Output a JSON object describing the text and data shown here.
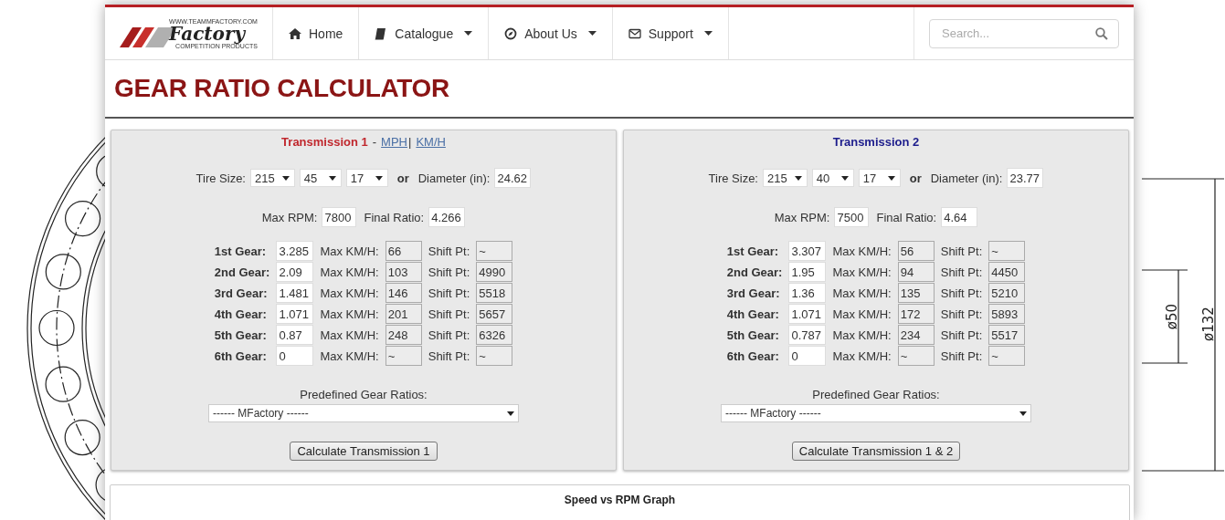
{
  "background_drawing": {
    "labels": [
      "ø50",
      "ø132"
    ]
  },
  "logo": {
    "url": "WWW.TEAMMFACTORY.COM",
    "wordmark": "Factory",
    "tagline": "COMPETITION PRODUCTS"
  },
  "nav": [
    {
      "label": "Home",
      "kind": "home",
      "dropdown": false
    },
    {
      "label": "Catalogue",
      "kind": "catalogue",
      "dropdown": true
    },
    {
      "label": "About Us",
      "kind": "about",
      "dropdown": true
    },
    {
      "label": "Support",
      "kind": "support",
      "dropdown": true
    }
  ],
  "search": {
    "placeholder": "Search..."
  },
  "page_title": "GEAR RATIO CALCULATOR",
  "transmissions": [
    {
      "title": "Transmission 1",
      "color": "#c0272d",
      "separator": "-",
      "units": [
        {
          "label": "MPH"
        },
        {
          "label": "KM/H"
        }
      ],
      "unit_separator": "|",
      "tire_label": "Tire Size:",
      "tire_selects": [
        "215",
        "45",
        "17"
      ],
      "or_label": "or",
      "diameter_label": "Diameter (in):",
      "diameter": "24.62",
      "max_rpm_label": "Max RPM:",
      "max_rpm": "7800",
      "final_ratio_label": "Final Ratio:",
      "final_ratio": "4.266",
      "gears": [
        {
          "label": "1st Gear:",
          "ratio": "3.285",
          "speed_label": "Max KM/H:",
          "speed": "66",
          "shift_label": "Shift Pt:",
          "shift": "~"
        },
        {
          "label": "2nd Gear:",
          "ratio": "2.09",
          "speed_label": "Max KM/H:",
          "speed": "103",
          "shift_label": "Shift Pt:",
          "shift": "4990"
        },
        {
          "label": "3rd Gear:",
          "ratio": "1.481",
          "speed_label": "Max KM/H:",
          "speed": "146",
          "shift_label": "Shift Pt:",
          "shift": "5518"
        },
        {
          "label": "4th Gear:",
          "ratio": "1.071",
          "speed_label": "Max KM/H:",
          "speed": "201",
          "shift_label": "Shift Pt:",
          "shift": "5657"
        },
        {
          "label": "5th Gear:",
          "ratio": "0.87",
          "speed_label": "Max KM/H:",
          "speed": "248",
          "shift_label": "Shift Pt:",
          "shift": "6326"
        },
        {
          "label": "6th Gear:",
          "ratio": "0",
          "speed_label": "Max KM/H:",
          "speed": "~",
          "shift_label": "Shift Pt:",
          "shift": "~"
        }
      ],
      "predefined_label": "Predefined Gear Ratios:",
      "predefined_value": "------ MFactory ------",
      "button": "Calculate Transmission 1"
    },
    {
      "title": "Transmission 2",
      "color": "#1c1c8c",
      "tire_label": "Tire Size:",
      "tire_selects": [
        "215",
        "40",
        "17"
      ],
      "or_label": "or",
      "diameter_label": "Diameter (in):",
      "diameter": "23.77",
      "max_rpm_label": "Max RPM:",
      "max_rpm": "7500",
      "final_ratio_label": "Final Ratio:",
      "final_ratio": "4.64",
      "gears": [
        {
          "label": "1st Gear:",
          "ratio": "3.307",
          "speed_label": "Max KM/H:",
          "speed": "56",
          "shift_label": "Shift Pt:",
          "shift": "~"
        },
        {
          "label": "2nd Gear:",
          "ratio": "1.95",
          "speed_label": "Max KM/H:",
          "speed": "94",
          "shift_label": "Shift Pt:",
          "shift": "4450"
        },
        {
          "label": "3rd Gear:",
          "ratio": "1.36",
          "speed_label": "Max KM/H:",
          "speed": "135",
          "shift_label": "Shift Pt:",
          "shift": "5210"
        },
        {
          "label": "4th Gear:",
          "ratio": "1.071",
          "speed_label": "Max KM/H:",
          "speed": "172",
          "shift_label": "Shift Pt:",
          "shift": "5893"
        },
        {
          "label": "5th Gear:",
          "ratio": "0.787",
          "speed_label": "Max KM/H:",
          "speed": "234",
          "shift_label": "Shift Pt:",
          "shift": "5517"
        },
        {
          "label": "6th Gear:",
          "ratio": "0",
          "speed_label": "Max KM/H:",
          "speed": "~",
          "shift_label": "Shift Pt:",
          "shift": "~"
        }
      ],
      "predefined_label": "Predefined Gear Ratios:",
      "predefined_value": "------ MFactory ------",
      "button": "Calculate Transmission 1 & 2"
    }
  ],
  "graph": {
    "title": "Speed vs RPM Graph"
  }
}
